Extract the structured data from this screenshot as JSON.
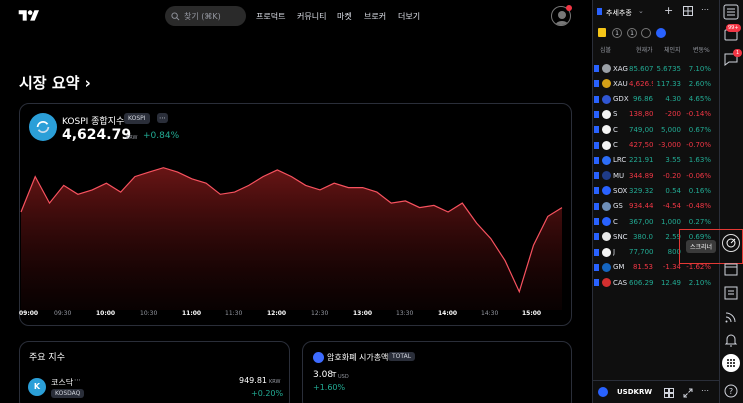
{
  "nav": {
    "search_placeholder": "찾기 (⌘K)",
    "items": [
      "프로덕트",
      "커뮤니티",
      "마켓",
      "브로커",
      "더보기"
    ]
  },
  "summary_title": "시장 요약 ›",
  "index": {
    "name": "KOSPI 종합지수",
    "badge": "KOSPI",
    "more": "⋯",
    "price": "4,624.79",
    "currency": "KRW",
    "change": "+0.84%"
  },
  "chart_data": {
    "type": "area",
    "x_ticks": [
      "09:00",
      "09:30",
      "10:00",
      "10:30",
      "11:00",
      "11:30",
      "12:00",
      "12:30",
      "13:00",
      "13:30",
      "14:00",
      "14:30",
      "15:00"
    ],
    "x": [
      "09:00",
      "09:10",
      "09:20",
      "09:30",
      "09:40",
      "09:50",
      "10:00",
      "10:10",
      "10:20",
      "10:30",
      "10:40",
      "10:50",
      "11:00",
      "11:10",
      "11:20",
      "11:30",
      "11:40",
      "11:50",
      "12:00",
      "12:10",
      "12:20",
      "12:30",
      "12:40",
      "12:50",
      "13:00",
      "13:10",
      "13:20",
      "13:30",
      "13:40",
      "13:50",
      "14:00",
      "14:10",
      "14:20",
      "14:30",
      "14:40",
      "14:50",
      "15:00",
      "15:10",
      "15:20"
    ],
    "values": [
      4632,
      4648,
      4636,
      4644,
      4640,
      4642,
      4645,
      4641,
      4648,
      4650,
      4652,
      4650,
      4647,
      4645,
      4640,
      4641,
      4644,
      4648,
      4651,
      4648,
      4644,
      4642,
      4645,
      4643,
      4643,
      4641,
      4636,
      4637,
      4634,
      4635,
      4632,
      4636,
      4627,
      4620,
      4610,
      4596,
      4617,
      4630,
      4634
    ],
    "ylim": [
      4590,
      4660
    ]
  },
  "cards": {
    "major_title": "주요 지수",
    "kosdaq_name": "코스닥",
    "kosdaq_more": "⋯",
    "kosdaq_badge": "KOSDAQ",
    "kosdaq_price": "949.81",
    "kosdaq_cur": "KRW",
    "kosdaq_change": "+0.20%",
    "crypto_title": "암호화폐 시가총액",
    "crypto_badge": "TOTAL",
    "crypto_value": "3.08",
    "crypto_unit": "T",
    "crypto_cur": "USD",
    "crypto_change": "+1.60%"
  },
  "watchlist": {
    "title": "추세추종",
    "tags": [
      "1",
      "1"
    ],
    "headers": [
      "심볼",
      "현재가",
      "체인지",
      "변동%"
    ],
    "rows": [
      {
        "sym": "XAG",
        "last": "85.607",
        "chg": "5.6735",
        "pct": "7.10%",
        "dir": "up",
        "color": "#9aa0a6"
      },
      {
        "sym": "XAU",
        "last": "4,626.9",
        "chg": "117.33",
        "pct": "2.60%",
        "dir": "mix",
        "color": "#d4a017"
      },
      {
        "sym": "GDX",
        "last": "96.86",
        "chg": "4.30",
        "pct": "4.65%",
        "dir": "up",
        "color": "#3056d3"
      },
      {
        "sym": "S",
        "last": "138,80",
        "chg": "-200",
        "pct": "-0.14%",
        "dir": "dn",
        "color": "#f5f5f5"
      },
      {
        "sym": "C",
        "last": "749,00",
        "chg": "5,000",
        "pct": "0.67%",
        "dir": "up",
        "color": "#f5f5f5"
      },
      {
        "sym": "C",
        "last": "427,50",
        "chg": "-3,000",
        "pct": "-0.70%",
        "dir": "dn",
        "color": "#f5f5f5"
      },
      {
        "sym": "LRC",
        "last": "221.91",
        "chg": "3.55",
        "pct": "1.63%",
        "dir": "up",
        "color": "#2d6df6"
      },
      {
        "sym": "MU",
        "last": "344.89",
        "chg": "-0.20",
        "pct": "-0.06%",
        "dir": "dn",
        "color": "#1f3c88"
      },
      {
        "sym": "SOX",
        "last": "329.32",
        "chg": "0.54",
        "pct": "0.16%",
        "dir": "up",
        "color": "#2962ff"
      },
      {
        "sym": "GS",
        "last": "934.44",
        "chg": "-4.54",
        "pct": "-0.48%",
        "dir": "dn",
        "color": "#6f8fb8"
      },
      {
        "sym": "C",
        "last": "367,00",
        "chg": "1,000",
        "pct": "0.27%",
        "dir": "up",
        "color": "#2962ff"
      },
      {
        "sym": "SNC",
        "last": "380.0",
        "chg": "2.59",
        "pct": "0.69%",
        "dir": "up",
        "color": "#e9e9e9"
      },
      {
        "sym": "J",
        "last": "77,700",
        "chg": "800",
        "pct": "",
        "dir": "up",
        "color": "#f5f5f5"
      },
      {
        "sym": "GM",
        "last": "81.53",
        "chg": "-1.34",
        "pct": "-1.62%",
        "dir": "dn",
        "color": "#1565c0"
      },
      {
        "sym": "CAS",
        "last": "606.29",
        "chg": "12.49",
        "pct": "2.10%",
        "dir": "up",
        "color": "#d32f2f"
      }
    ],
    "footer_symbol": "USDKRW"
  },
  "rightbar": {
    "badge_99": "99+",
    "badge_1": "1",
    "tooltip": "스크리너"
  }
}
